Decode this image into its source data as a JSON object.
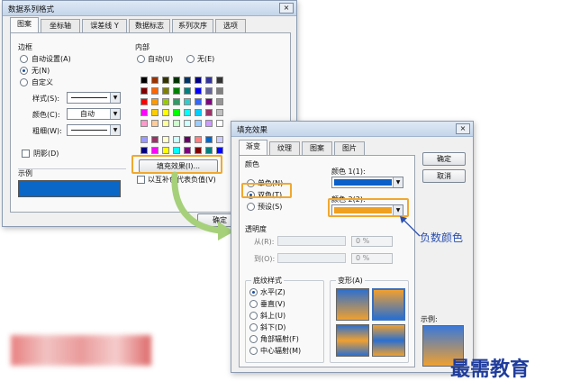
{
  "main_dialog": {
    "title": "数据系列格式",
    "close": "×",
    "tabs": [
      "图案",
      "坐标轴",
      "误差线 Y",
      "数据标志",
      "系列次序",
      "选项"
    ],
    "border": {
      "label": "边框",
      "auto": "自动设置(A)",
      "none": "无(N)",
      "custom": "自定义",
      "style": "样式(S):",
      "color": "颜色(C):",
      "color_value": "自动",
      "weight": "粗细(W):",
      "shadow": "阴影(D)"
    },
    "sample": "示例",
    "inside": {
      "label": "内部",
      "auto": "自动(U)",
      "none": "无(E)",
      "fill_button": "填充效果(I)...",
      "invert": "以互补色代表负值(V)"
    },
    "ok": "确定"
  },
  "fill_dialog": {
    "title": "填充效果",
    "close": "×",
    "tabs": [
      "渐变",
      "纹理",
      "图案",
      "图片"
    ],
    "ok": "确定",
    "cancel": "取消",
    "colors": {
      "label": "颜色",
      "one": "单色(N)",
      "two": "双色(T)",
      "preset": "预设(S)",
      "color1": "颜色 1(1):",
      "color2": "颜色 2(2):"
    },
    "transparency": {
      "label": "透明度",
      "from": "从(R):",
      "to": "到(O):",
      "from_value": "0 %",
      "to_value": "0 %"
    },
    "shading": {
      "label": "底纹样式",
      "items": [
        "水平(Z)",
        "垂直(V)",
        "斜上(U)",
        "斜下(D)",
        "角部辐射(F)",
        "中心辐射(M)"
      ]
    },
    "variants": "变形(A)",
    "sample": "示例:"
  },
  "annotation": "负数颜色",
  "watermark": "最需教育",
  "colors": {
    "sample_fill": "#0a67c8",
    "color1": "#0a5fc8",
    "color2": "#f0a020",
    "annotation": "#2a4fb0",
    "watermark": "#1f3c9c",
    "frame": "#f0a830"
  }
}
